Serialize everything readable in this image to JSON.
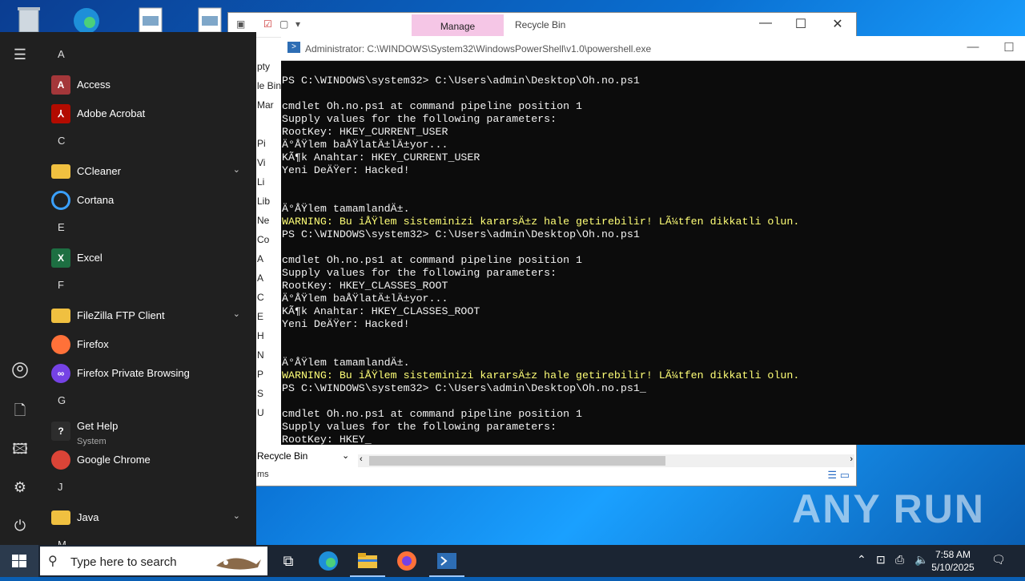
{
  "explorer": {
    "manage_tab": "Manage",
    "title": "Recycle Bin",
    "left_items": [
      "pty",
      "le Bin",
      "Mar",
      "",
      "Pi",
      "Vi",
      "Li",
      "Lib",
      "Ne",
      "Co",
      "A",
      "A",
      "C",
      "E",
      "H",
      "N",
      "P",
      "S",
      "U"
    ],
    "nav_bottom": "Recycle Bin",
    "status": "ms"
  },
  "powershell": {
    "title": "Administrator: C:\\WINDOWS\\System32\\WindowsPowerShell\\v1.0\\powershell.exe",
    "lines": [
      {
        "t": "PS C:\\WINDOWS\\system32> C:\\Users\\admin\\Desktop\\Oh.no.ps1",
        "w": false
      },
      {
        "t": "",
        "w": false
      },
      {
        "t": "cmdlet Oh.no.ps1 at command pipeline position 1",
        "w": false
      },
      {
        "t": "Supply values for the following parameters:",
        "w": false
      },
      {
        "t": "RootKey: HKEY_CURRENT_USER",
        "w": false
      },
      {
        "t": "Ä°ÅŸlem baÅŸlatÄ±lÄ±yor...",
        "w": false
      },
      {
        "t": "KÃ¶k Anahtar: HKEY_CURRENT_USER",
        "w": false
      },
      {
        "t": "Yeni DeÄŸer: Hacked!",
        "w": false
      },
      {
        "t": "",
        "w": false
      },
      {
        "t": "",
        "w": false
      },
      {
        "t": "Ä°ÅŸlem tamamlandÄ±.",
        "w": false
      },
      {
        "t": "WARNING: Bu iÅŸlem sisteminizi kararsÄ±z hale getirebilir! LÃ¼tfen dikkatli olun.",
        "w": true
      },
      {
        "t": "PS C:\\WINDOWS\\system32> C:\\Users\\admin\\Desktop\\Oh.no.ps1",
        "w": false
      },
      {
        "t": "",
        "w": false
      },
      {
        "t": "cmdlet Oh.no.ps1 at command pipeline position 1",
        "w": false
      },
      {
        "t": "Supply values for the following parameters:",
        "w": false
      },
      {
        "t": "RootKey: HKEY_CLASSES_ROOT",
        "w": false
      },
      {
        "t": "Ä°ÅŸlem baÅŸlatÄ±lÄ±yor...",
        "w": false
      },
      {
        "t": "KÃ¶k Anahtar: HKEY_CLASSES_ROOT",
        "w": false
      },
      {
        "t": "Yeni DeÄŸer: Hacked!",
        "w": false
      },
      {
        "t": "",
        "w": false
      },
      {
        "t": "",
        "w": false
      },
      {
        "t": "Ä°ÅŸlem tamamlandÄ±.",
        "w": false
      },
      {
        "t": "WARNING: Bu iÅŸlem sisteminizi kararsÄ±z hale getirebilir! LÃ¼tfen dikkatli olun.",
        "w": true
      },
      {
        "t": "PS C:\\WINDOWS\\system32> C:\\Users\\admin\\Desktop\\Oh.no.ps1_",
        "w": false
      },
      {
        "t": "",
        "w": false
      },
      {
        "t": "cmdlet Oh.no.ps1 at command pipeline position 1",
        "w": false
      },
      {
        "t": "Supply values for the following parameters:",
        "w": false
      },
      {
        "t": "RootKey: HKEY_",
        "w": false
      }
    ]
  },
  "start_menu": {
    "entries": [
      {
        "kind": "letter",
        "text": "A"
      },
      {
        "kind": "app",
        "name": "Access",
        "icon": "access-icon",
        "color": "#a4373a",
        "glyph": "A"
      },
      {
        "kind": "app",
        "name": "Adobe Acrobat",
        "icon": "acrobat-icon",
        "color": "#b30b00",
        "glyph": "⅄"
      },
      {
        "kind": "letter",
        "text": "C"
      },
      {
        "kind": "app",
        "name": "CCleaner",
        "icon": "folder-icon",
        "color": "#f0c040",
        "glyph": "",
        "expand": true
      },
      {
        "kind": "app",
        "name": "Cortana",
        "icon": "cortana-icon",
        "color": "ring",
        "glyph": ""
      },
      {
        "kind": "letter",
        "text": "E"
      },
      {
        "kind": "app",
        "name": "Excel",
        "icon": "excel-icon",
        "color": "#1d6f42",
        "glyph": "X"
      },
      {
        "kind": "letter",
        "text": "F"
      },
      {
        "kind": "app",
        "name": "FileZilla FTP Client",
        "icon": "folder-icon",
        "color": "#f0c040",
        "glyph": "",
        "expand": true
      },
      {
        "kind": "app",
        "name": "Firefox",
        "icon": "firefox-icon",
        "color": "#ff7139",
        "glyph": ""
      },
      {
        "kind": "app",
        "name": "Firefox Private Browsing",
        "icon": "firefox-private-icon",
        "color": "#7542e5",
        "glyph": "∞"
      },
      {
        "kind": "letter",
        "text": "G"
      },
      {
        "kind": "app",
        "name": "Get Help",
        "sub": "System",
        "icon": "get-help-icon",
        "color": "#2d2d2d",
        "glyph": "?"
      },
      {
        "kind": "app",
        "name": "Google Chrome",
        "icon": "chrome-icon",
        "color": "#db4437",
        "glyph": ""
      },
      {
        "kind": "letter",
        "text": "J"
      },
      {
        "kind": "app",
        "name": "Java",
        "icon": "folder-icon",
        "color": "#f0c040",
        "glyph": "",
        "expand": true
      },
      {
        "kind": "letter",
        "text": "M"
      }
    ]
  },
  "taskbar": {
    "search_placeholder": "Type here to search",
    "time": "7:58 AM",
    "date": "5/10/2025"
  },
  "watermark": "ANY RUN"
}
